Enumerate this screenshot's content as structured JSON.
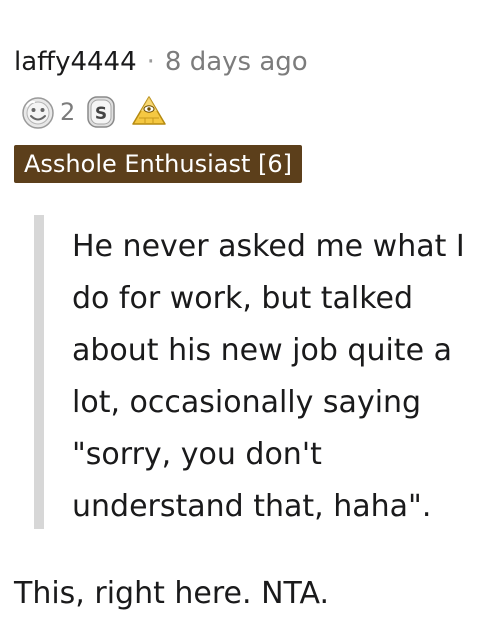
{
  "comment": {
    "username": "laffy4444",
    "separator": "·",
    "age": "8 days ago",
    "awards": [
      {
        "icon": "silver-award-icon",
        "count": "2"
      },
      {
        "icon": "coin-s-award-icon",
        "count": ""
      },
      {
        "icon": "pyramid-award-icon",
        "count": ""
      }
    ],
    "flair": "Asshole Enthusiast [6]",
    "quote": "He never asked me what I do for work, but talked about his new job quite a lot, occasionally saying \"sorry, you don't understand that, haha\".",
    "body": "This, right here. NTA.",
    "colors": {
      "flair_background": "#5c3f1b",
      "quote_bar": "#d7d7d7",
      "muted_text": "#7c7c7c"
    }
  }
}
